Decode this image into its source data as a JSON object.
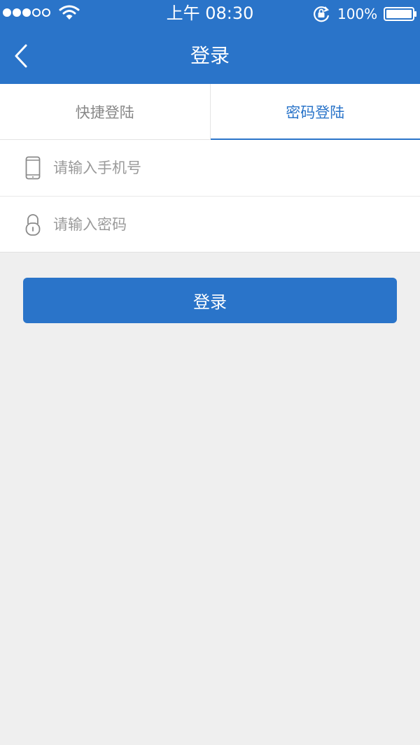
{
  "status_bar": {
    "time": "上午 08:30",
    "battery_percent": "100%",
    "signal_bars_filled": 3,
    "signal_bars_total": 5,
    "icons": [
      "wifi-icon",
      "rotation-lock-icon",
      "battery-icon"
    ]
  },
  "nav": {
    "title": "登录",
    "back_icon": "chevron-left-icon"
  },
  "tabs": [
    {
      "label": "快捷登陆",
      "active": false
    },
    {
      "label": "密码登陆",
      "active": true
    }
  ],
  "form": {
    "phone": {
      "placeholder": "请输入手机号",
      "value": "",
      "icon": "phone-icon"
    },
    "password": {
      "placeholder": "请输入密码",
      "value": "",
      "icon": "lock-icon"
    }
  },
  "login_button": {
    "label": "登录"
  },
  "colors": {
    "brand": "#2a74c9",
    "background": "#efefef",
    "placeholder": "#9a9a9a",
    "inactive_tab": "#888888"
  }
}
